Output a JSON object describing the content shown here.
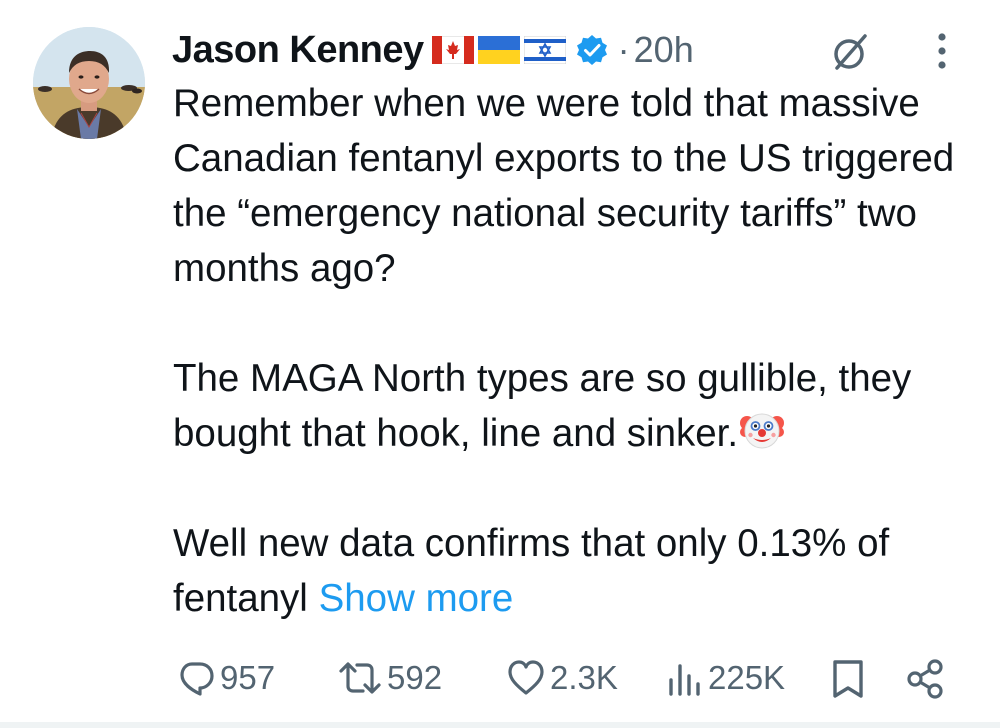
{
  "author": {
    "name": "Jason Kenney",
    "flags": [
      "canada-flag",
      "ukraine-flag",
      "israel-flag"
    ],
    "verified": true,
    "time_separator": "·",
    "timestamp": "20h"
  },
  "body": {
    "paragraph1": "Remember when we were told that massive Canadian fentanyl exports to the US triggered the “emergency national security tariffs” two months ago?",
    "paragraph2": "The MAGA North types are so gullible, they bought that hook, line and sinker.",
    "paragraph2_emoji": "clown-face-icon",
    "paragraph3": "Well new data confirms that only 0.13% of fentanyl",
    "show_more": "Show more"
  },
  "actions": {
    "replies": "957",
    "reposts": "592",
    "likes": "2.3K",
    "views": "225K"
  },
  "icons": [
    "grok-icon",
    "more-options-icon",
    "reply-icon",
    "repost-icon",
    "like-icon",
    "views-icon",
    "bookmark-icon",
    "share-icon"
  ],
  "colors": {
    "text": "#0f1419",
    "secondary": "#536471",
    "link": "#1d9bf0",
    "verified": "#1d9bf0"
  }
}
